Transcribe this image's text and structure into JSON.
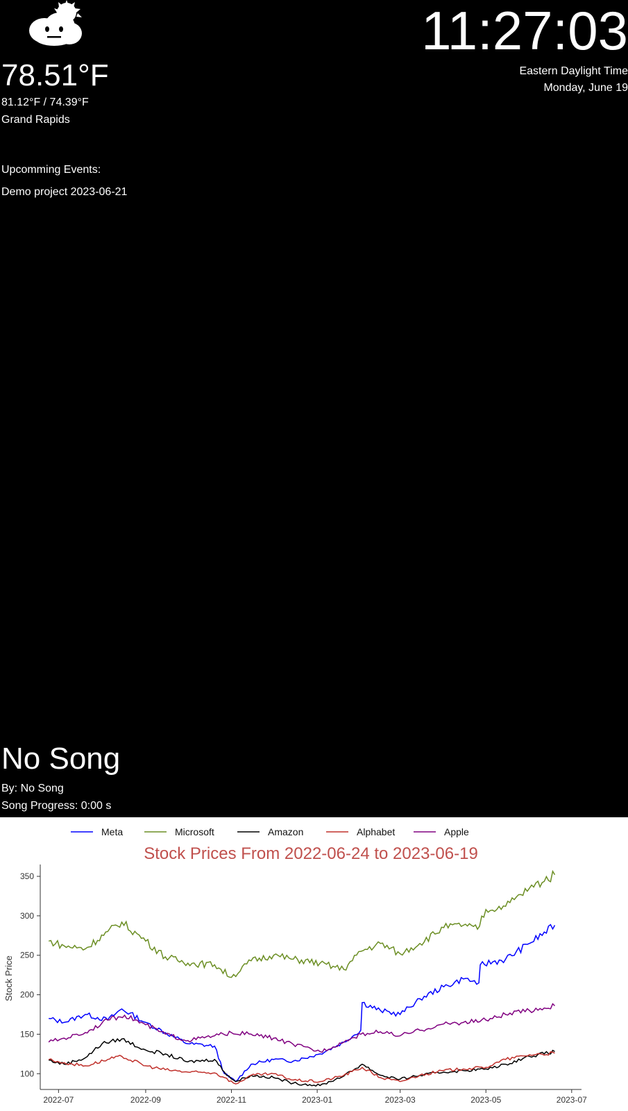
{
  "weather": {
    "icon": "cloud-sun-icon",
    "temperature": "78.51°F",
    "high_low": "81.12°F / 74.39°F",
    "city": "Grand Rapids"
  },
  "clock": {
    "time": "11:27:03",
    "timezone": "Eastern Daylight Time",
    "date": "Monday, June 19"
  },
  "events": {
    "title": "Upcomming Events:",
    "items": [
      "Demo project 2023-06-21"
    ]
  },
  "song": {
    "title": "No Song",
    "artist": "By: No Song",
    "progress": "Song Progress: 0:00 s"
  },
  "chart_data": {
    "type": "line",
    "title": "Stock Prices From 2022-06-24 to 2023-06-19",
    "ylabel": "Stock Price",
    "xlabel": "",
    "x_ticks": [
      "2022-07",
      "2022-09",
      "2022-11",
      "2023-01",
      "2023-03",
      "2023-05",
      "2023-07"
    ],
    "y_ticks": [
      100,
      150,
      200,
      250,
      300,
      350
    ],
    "ylim": [
      80,
      365
    ],
    "xlim": [
      "2022-06-18",
      "2023-07-08"
    ],
    "legend_position": "top",
    "grid": false,
    "series": [
      {
        "name": "Meta",
        "color": "#0000ff",
        "points": [
          [
            "2022-06-24",
            170
          ],
          [
            "2022-07-05",
            165
          ],
          [
            "2022-07-20",
            175
          ],
          [
            "2022-08-05",
            168
          ],
          [
            "2022-08-15",
            182
          ],
          [
            "2022-09-01",
            165
          ],
          [
            "2022-09-15",
            152
          ],
          [
            "2022-10-01",
            138
          ],
          [
            "2022-10-20",
            135
          ],
          [
            "2022-10-27",
            100
          ],
          [
            "2022-11-04",
            90
          ],
          [
            "2022-11-15",
            112
          ],
          [
            "2022-12-01",
            118
          ],
          [
            "2022-12-15",
            116
          ],
          [
            "2023-01-03",
            125
          ],
          [
            "2023-01-20",
            140
          ],
          [
            "2023-02-01",
            155
          ],
          [
            "2023-02-02",
            190
          ],
          [
            "2023-02-15",
            180
          ],
          [
            "2023-03-01",
            175
          ],
          [
            "2023-03-15",
            195
          ],
          [
            "2023-04-01",
            210
          ],
          [
            "2023-04-15",
            220
          ],
          [
            "2023-04-26",
            215
          ],
          [
            "2023-04-27",
            238
          ],
          [
            "2023-05-15",
            245
          ],
          [
            "2023-06-01",
            265
          ],
          [
            "2023-06-19",
            288
          ]
        ]
      },
      {
        "name": "Microsoft",
        "color": "#6b8e23",
        "points": [
          [
            "2022-06-24",
            268
          ],
          [
            "2022-07-05",
            262
          ],
          [
            "2022-07-20",
            258
          ],
          [
            "2022-08-05",
            280
          ],
          [
            "2022-08-15",
            292
          ],
          [
            "2022-09-01",
            268
          ],
          [
            "2022-09-15",
            248
          ],
          [
            "2022-10-01",
            240
          ],
          [
            "2022-10-20",
            238
          ],
          [
            "2022-11-01",
            222
          ],
          [
            "2022-11-15",
            243
          ],
          [
            "2022-12-01",
            250
          ],
          [
            "2022-12-15",
            245
          ],
          [
            "2023-01-03",
            240
          ],
          [
            "2023-01-20",
            232
          ],
          [
            "2023-02-01",
            255
          ],
          [
            "2023-02-15",
            265
          ],
          [
            "2023-03-01",
            252
          ],
          [
            "2023-03-15",
            265
          ],
          [
            "2023-04-01",
            285
          ],
          [
            "2023-04-15",
            288
          ],
          [
            "2023-04-25",
            283
          ],
          [
            "2023-05-01",
            308
          ],
          [
            "2023-05-15",
            312
          ],
          [
            "2023-06-01",
            335
          ],
          [
            "2023-06-19",
            352
          ]
        ]
      },
      {
        "name": "Amazon",
        "color": "#000000",
        "points": [
          [
            "2022-06-24",
            117
          ],
          [
            "2022-07-05",
            112
          ],
          [
            "2022-07-20",
            120
          ],
          [
            "2022-08-01",
            138
          ],
          [
            "2022-08-15",
            144
          ],
          [
            "2022-09-01",
            130
          ],
          [
            "2022-09-15",
            125
          ],
          [
            "2022-10-01",
            115
          ],
          [
            "2022-10-20",
            118
          ],
          [
            "2022-10-27",
            102
          ],
          [
            "2022-11-04",
            90
          ],
          [
            "2022-11-15",
            98
          ],
          [
            "2022-12-01",
            95
          ],
          [
            "2022-12-15",
            88
          ],
          [
            "2023-01-03",
            85
          ],
          [
            "2023-01-20",
            97
          ],
          [
            "2023-02-02",
            112
          ],
          [
            "2023-02-15",
            98
          ],
          [
            "2023-03-01",
            93
          ],
          [
            "2023-03-15",
            98
          ],
          [
            "2023-04-01",
            102
          ],
          [
            "2023-04-15",
            104
          ],
          [
            "2023-05-01",
            106
          ],
          [
            "2023-05-15",
            112
          ],
          [
            "2023-06-01",
            122
          ],
          [
            "2023-06-19",
            128
          ]
        ]
      },
      {
        "name": "Alphabet",
        "color": "#c0302b",
        "points": [
          [
            "2022-06-24",
            118
          ],
          [
            "2022-07-05",
            114
          ],
          [
            "2022-07-20",
            110
          ],
          [
            "2022-08-05",
            118
          ],
          [
            "2022-08-15",
            122
          ],
          [
            "2022-09-01",
            110
          ],
          [
            "2022-09-15",
            105
          ],
          [
            "2022-10-01",
            102
          ],
          [
            "2022-10-20",
            101
          ],
          [
            "2022-10-27",
            95
          ],
          [
            "2022-11-04",
            87
          ],
          [
            "2022-11-15",
            98
          ],
          [
            "2022-12-01",
            100
          ],
          [
            "2022-12-15",
            92
          ],
          [
            "2023-01-03",
            90
          ],
          [
            "2023-01-20",
            98
          ],
          [
            "2023-02-02",
            108
          ],
          [
            "2023-02-15",
            95
          ],
          [
            "2023-03-01",
            90
          ],
          [
            "2023-03-15",
            98
          ],
          [
            "2023-04-01",
            104
          ],
          [
            "2023-04-15",
            106
          ],
          [
            "2023-05-01",
            108
          ],
          [
            "2023-05-15",
            118
          ],
          [
            "2023-06-01",
            124
          ],
          [
            "2023-06-19",
            126
          ]
        ]
      },
      {
        "name": "Apple",
        "color": "#800080",
        "points": [
          [
            "2022-06-24",
            140
          ],
          [
            "2022-07-05",
            145
          ],
          [
            "2022-07-20",
            152
          ],
          [
            "2022-08-05",
            168
          ],
          [
            "2022-08-17",
            174
          ],
          [
            "2022-09-01",
            162
          ],
          [
            "2022-09-15",
            150
          ],
          [
            "2022-10-01",
            142
          ],
          [
            "2022-10-20",
            148
          ],
          [
            "2022-11-01",
            152
          ],
          [
            "2022-11-15",
            150
          ],
          [
            "2022-12-01",
            145
          ],
          [
            "2022-12-15",
            137
          ],
          [
            "2023-01-03",
            128
          ],
          [
            "2023-01-20",
            140
          ],
          [
            "2023-02-01",
            150
          ],
          [
            "2023-02-15",
            153
          ],
          [
            "2023-03-01",
            148
          ],
          [
            "2023-03-15",
            155
          ],
          [
            "2023-04-01",
            163
          ],
          [
            "2023-04-15",
            165
          ],
          [
            "2023-05-01",
            168
          ],
          [
            "2023-05-15",
            175
          ],
          [
            "2023-06-01",
            180
          ],
          [
            "2023-06-19",
            186
          ]
        ]
      }
    ]
  }
}
